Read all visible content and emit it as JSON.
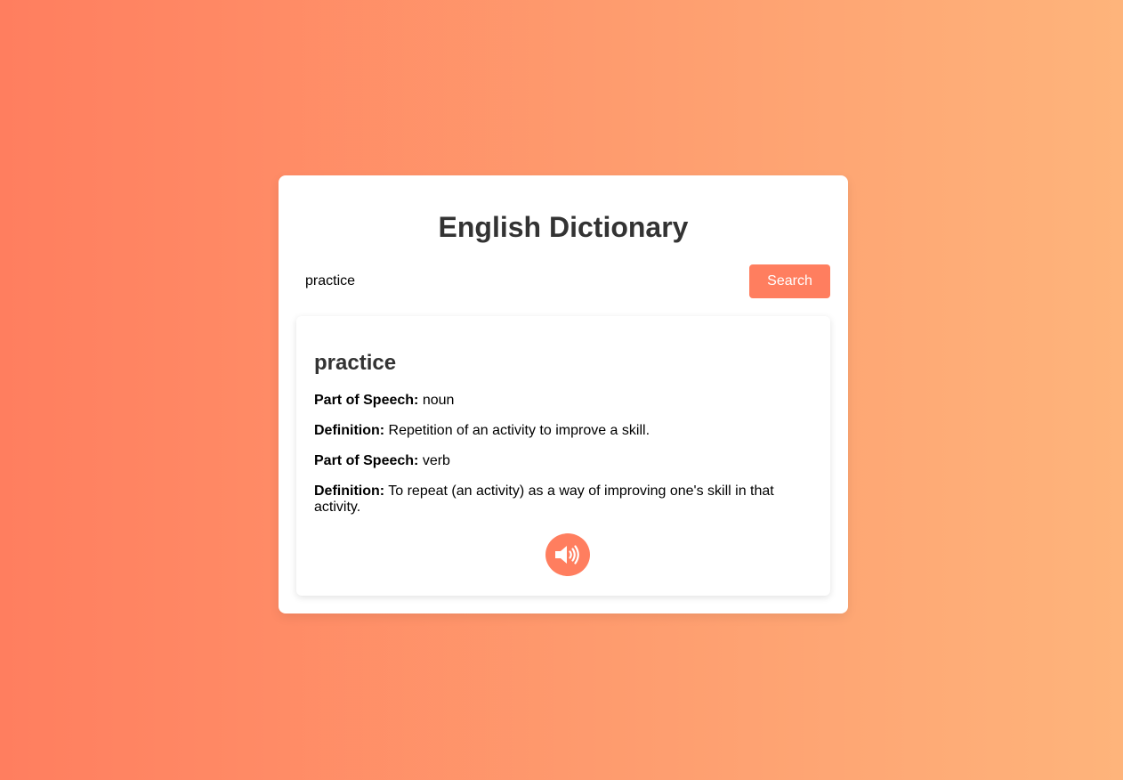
{
  "app": {
    "title": "English Dictionary"
  },
  "search": {
    "value": "practice",
    "button_label": "Search"
  },
  "result": {
    "word": "practice",
    "entries": [
      {
        "label": "Part of Speech:",
        "value": "noun"
      },
      {
        "label": "Definition:",
        "value": "Repetition of an activity to improve a skill."
      },
      {
        "label": "Part of Speech:",
        "value": "verb"
      },
      {
        "label": "Definition:",
        "value": "To repeat (an activity) as a way of improving one's skill in that activity."
      }
    ],
    "audio_icon": "speaker-volume-icon"
  },
  "colors": {
    "gradient_start": "#ff7e5f",
    "gradient_end": "#feb47b",
    "accent": "#ff7e5f",
    "card": "#ffffff",
    "heading": "#333333"
  }
}
